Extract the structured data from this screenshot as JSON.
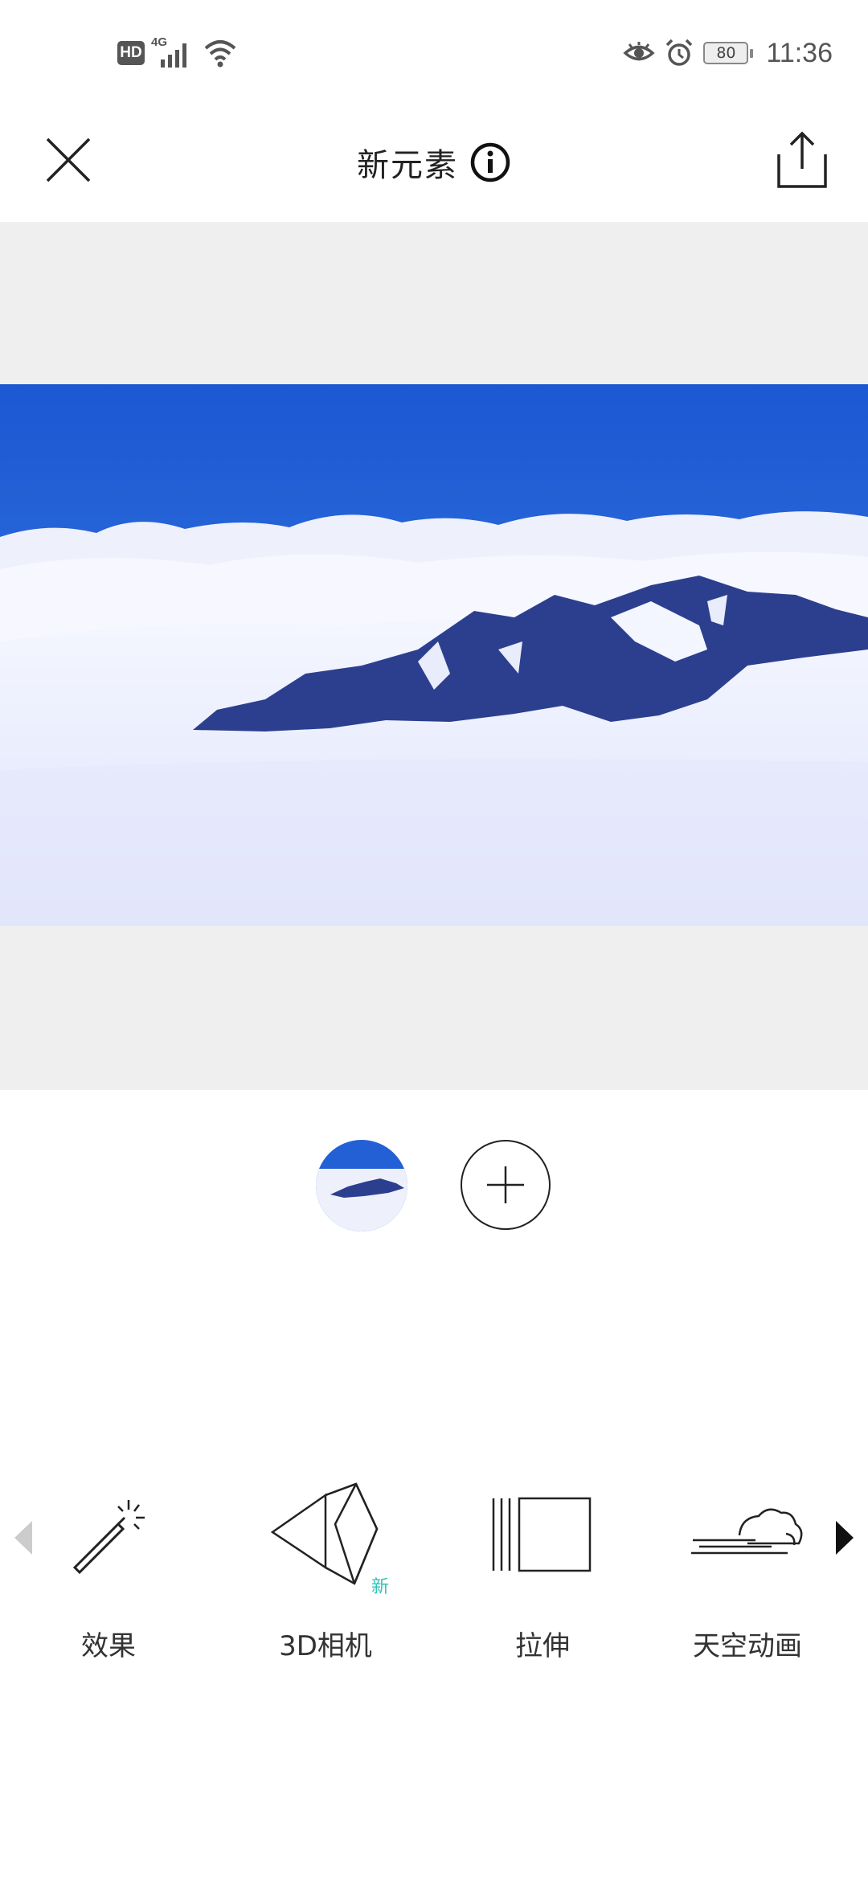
{
  "status_bar": {
    "hd": "HD",
    "network": "4G",
    "battery": "80",
    "time": "11:36"
  },
  "app_bar": {
    "title": "新元素"
  },
  "toolbar": {
    "tools": [
      {
        "label": "效果",
        "icon": "magic-wand-icon"
      },
      {
        "label": "3D相机",
        "icon": "3d-camera-icon",
        "badge": "新"
      },
      {
        "label": "拉伸",
        "icon": "stretch-icon"
      },
      {
        "label": "天空动画",
        "icon": "sky-cloud-icon"
      }
    ]
  },
  "colors": {
    "accent_badge": "#2ec4b6",
    "canvas_bg": "#efefef",
    "sky": "#1d5fd6"
  }
}
